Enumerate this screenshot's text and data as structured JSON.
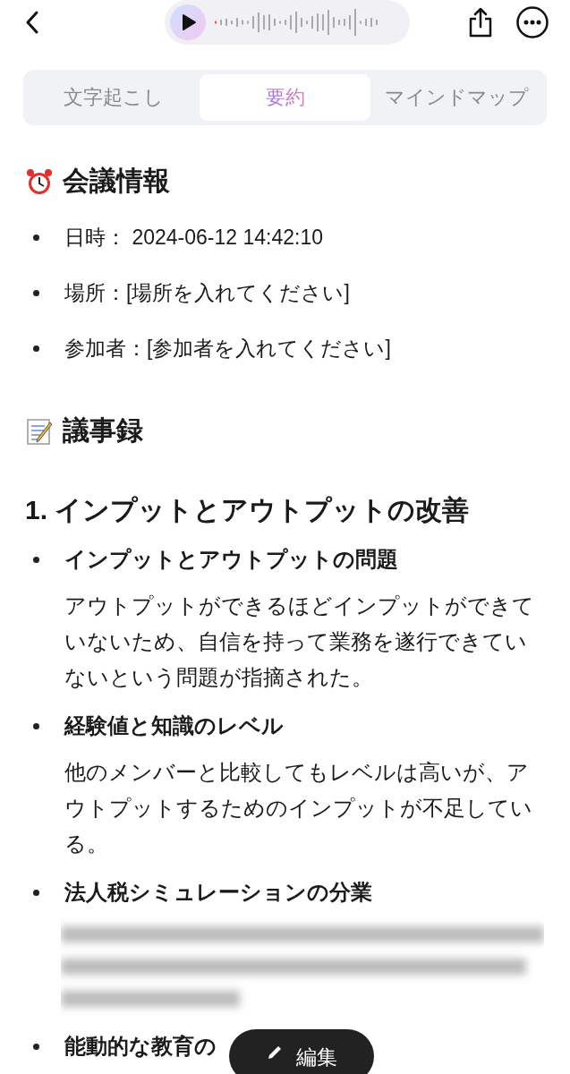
{
  "tabs": [
    {
      "label": "文字起こし",
      "selected": false
    },
    {
      "label": "要約",
      "selected": true
    },
    {
      "label": "マインドマップ",
      "selected": false
    }
  ],
  "meeting_info": {
    "heading": "会議情報",
    "items": [
      "日時：  2024-06-12 14:42:10",
      "場所：[場所を入れてください]",
      "参加者：[参加者を入れてください]"
    ]
  },
  "minutes": {
    "heading": "議事録",
    "sections": [
      {
        "title": "1. インプットとアウトプットの改善",
        "points": [
          {
            "title": "インプットとアウトプットの問題",
            "body": "アウトプットができるほどインプットができていないため、自信を持って業務を遂行できていないという問題が指摘された。",
            "blurred": false
          },
          {
            "title": "経験値と知識のレベル",
            "body": "他のメンバーと比較してもレベルは高いが、アウトプットするためのインプットが不足している。",
            "blurred": false
          },
          {
            "title": "法人税シミュレーションの分業",
            "blurred": true
          },
          {
            "title": "能動的な教育の",
            "blurred": false
          }
        ]
      }
    ]
  },
  "edit_button": {
    "label": "編集"
  }
}
